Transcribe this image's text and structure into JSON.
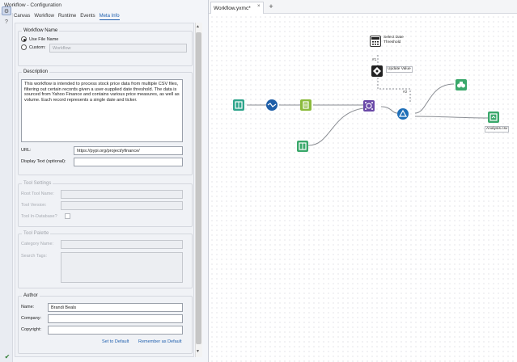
{
  "window": {
    "pane_title": "Workflow - Configuration",
    "title_icons": [
      "chevron-down-icon",
      "pin-icon"
    ]
  },
  "tabs": [
    {
      "label": "Canvas",
      "active": false
    },
    {
      "label": "Workflow",
      "active": false
    },
    {
      "label": "Runtime",
      "active": false
    },
    {
      "label": "Events",
      "active": false
    },
    {
      "label": "Meta Info",
      "active": true
    }
  ],
  "workflow_name": {
    "group_title": "Workflow Name",
    "use_file_name_label": "Use File Name",
    "use_file_name_selected": true,
    "custom_label": "Custom:",
    "custom_value": "Workflow"
  },
  "description": {
    "group_title": "Description",
    "text": "This workflow is intended to process stock price data from multiple CSV files, filtering out certain records given a user-supplied date threshold. The data is sourced from Yahoo Finance and contains various price measures, as well as volume. Each record represents a single date and ticker.",
    "url_label": "URL:",
    "url_value": "https://pypi.org/project/yfinance/",
    "display_text_label": "Display Text (optional):",
    "display_text_value": ""
  },
  "tool_settings": {
    "group_title": "Tool Settings",
    "root_tool_name_label": "Root Tool Name:",
    "tool_version_label": "Tool Version:",
    "in_database_label": "Tool In-Database?"
  },
  "tool_palette": {
    "group_title": "Tool Palette",
    "category_name_label": "Category Name:",
    "search_tags_label": "Search Tags:"
  },
  "author": {
    "group_title": "Author",
    "name_label": "Name:",
    "name_value": "Brandi Beals",
    "company_label": "Company:",
    "company_value": "",
    "copyright_label": "Copyright:",
    "copyright_value": "",
    "set_default_link": "Set to Default",
    "remember_default_link": "Remember as Default"
  },
  "canvas": {
    "tab_title": "Workflow.yxmc*",
    "tab_close": "×",
    "new_tab": "+",
    "tools": [
      {
        "name": "input-data-tool-1",
        "icon": "book-icon",
        "color": "#2fa58c"
      },
      {
        "name": "multi-field-formula-tool",
        "icon": "wave-icon",
        "color": "#1f5fa8"
      },
      {
        "name": "select-tool",
        "icon": "select-icon",
        "color": "#8bbb3c"
      },
      {
        "name": "union-tool",
        "icon": "union-icon",
        "color": "#6b4aa8"
      },
      {
        "name": "filter-tool",
        "icon": "triangle-icon",
        "color": "#1f6fb8"
      },
      {
        "name": "browse-tool",
        "icon": "binoculars-icon",
        "color": "#3aa86b"
      },
      {
        "name": "output-data-tool",
        "icon": "output-icon",
        "color": "#3aa86b"
      },
      {
        "name": "input-data-tool-2",
        "icon": "book-icon",
        "color": "#3aa86b"
      },
      {
        "name": "date-interface-tool",
        "icon": "calendar-icon",
        "color": "#222222"
      },
      {
        "name": "action-tool",
        "icon": "action-icon",
        "color": "#222222"
      }
    ],
    "labels": {
      "date_tool": "Select Date\nThreshold",
      "action_tool": "Update Value",
      "output_tool": "Analysis.csv"
    },
    "notes": {
      "n1": "#1",
      "n2": "#2"
    },
    "connection_color": "#8a8d93"
  }
}
